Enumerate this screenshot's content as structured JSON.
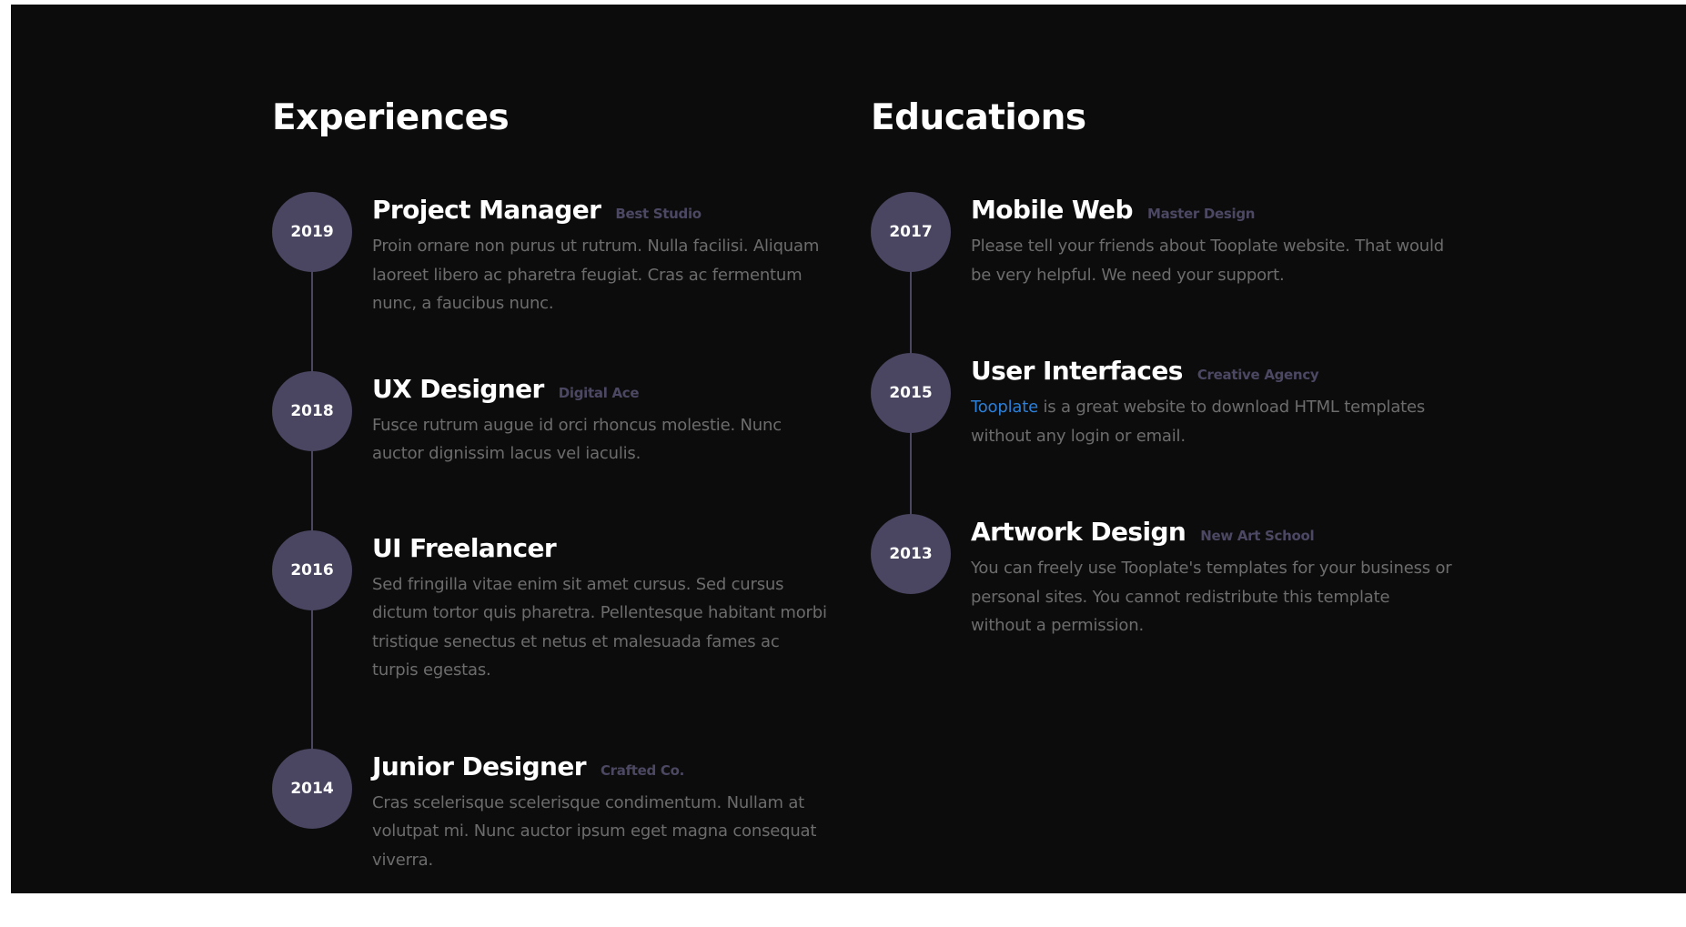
{
  "experiences": {
    "title": "Experiences",
    "items": [
      {
        "year": "2019",
        "title": "Project Manager",
        "org": "Best Studio",
        "description": "Proin ornare non purus ut rutrum. Nulla facilisi. Aliquam laoreet libero ac pharetra feugiat. Cras ac fermentum nunc, a faucibus nunc."
      },
      {
        "year": "2018",
        "title": "UX Designer",
        "org": "Digital Ace",
        "description": "Fusce rutrum augue id orci rhoncus molestie. Nunc auctor dignissim lacus vel iaculis."
      },
      {
        "year": "2016",
        "title": "UI Freelancer",
        "org": "",
        "description": "Sed fringilla vitae enim sit amet cursus. Sed cursus dictum tortor quis pharetra. Pellentesque habitant morbi tristique senectus et netus et malesuada fames ac turpis egestas."
      },
      {
        "year": "2014",
        "title": "Junior Designer",
        "org": "Crafted Co.",
        "description": "Cras scelerisque scelerisque condimentum. Nullam at volutpat mi. Nunc auctor ipsum eget magna consequat viverra."
      }
    ]
  },
  "educations": {
    "title": "Educations",
    "items": [
      {
        "year": "2017",
        "title": "Mobile Web",
        "org": "Master Design",
        "description": "Please tell your friends about Tooplate website. That would be very helpful. We need your support."
      },
      {
        "year": "2015",
        "title": "User Interfaces",
        "org": "Creative Agency",
        "link_text": "Tooplate",
        "description": " is a great website to download HTML templates without any login or email."
      },
      {
        "year": "2013",
        "title": "Artwork Design",
        "org": "New Art School",
        "description": "You can freely use Tooplate's templates for your business or personal sites. You cannot redistribute this template without a permission."
      }
    ]
  },
  "colors": {
    "background": "#0c0c0c",
    "badge": "#4a4560",
    "org_text": "#4c4762",
    "body_text": "#6c6c6c",
    "link": "#2b7fd9"
  }
}
